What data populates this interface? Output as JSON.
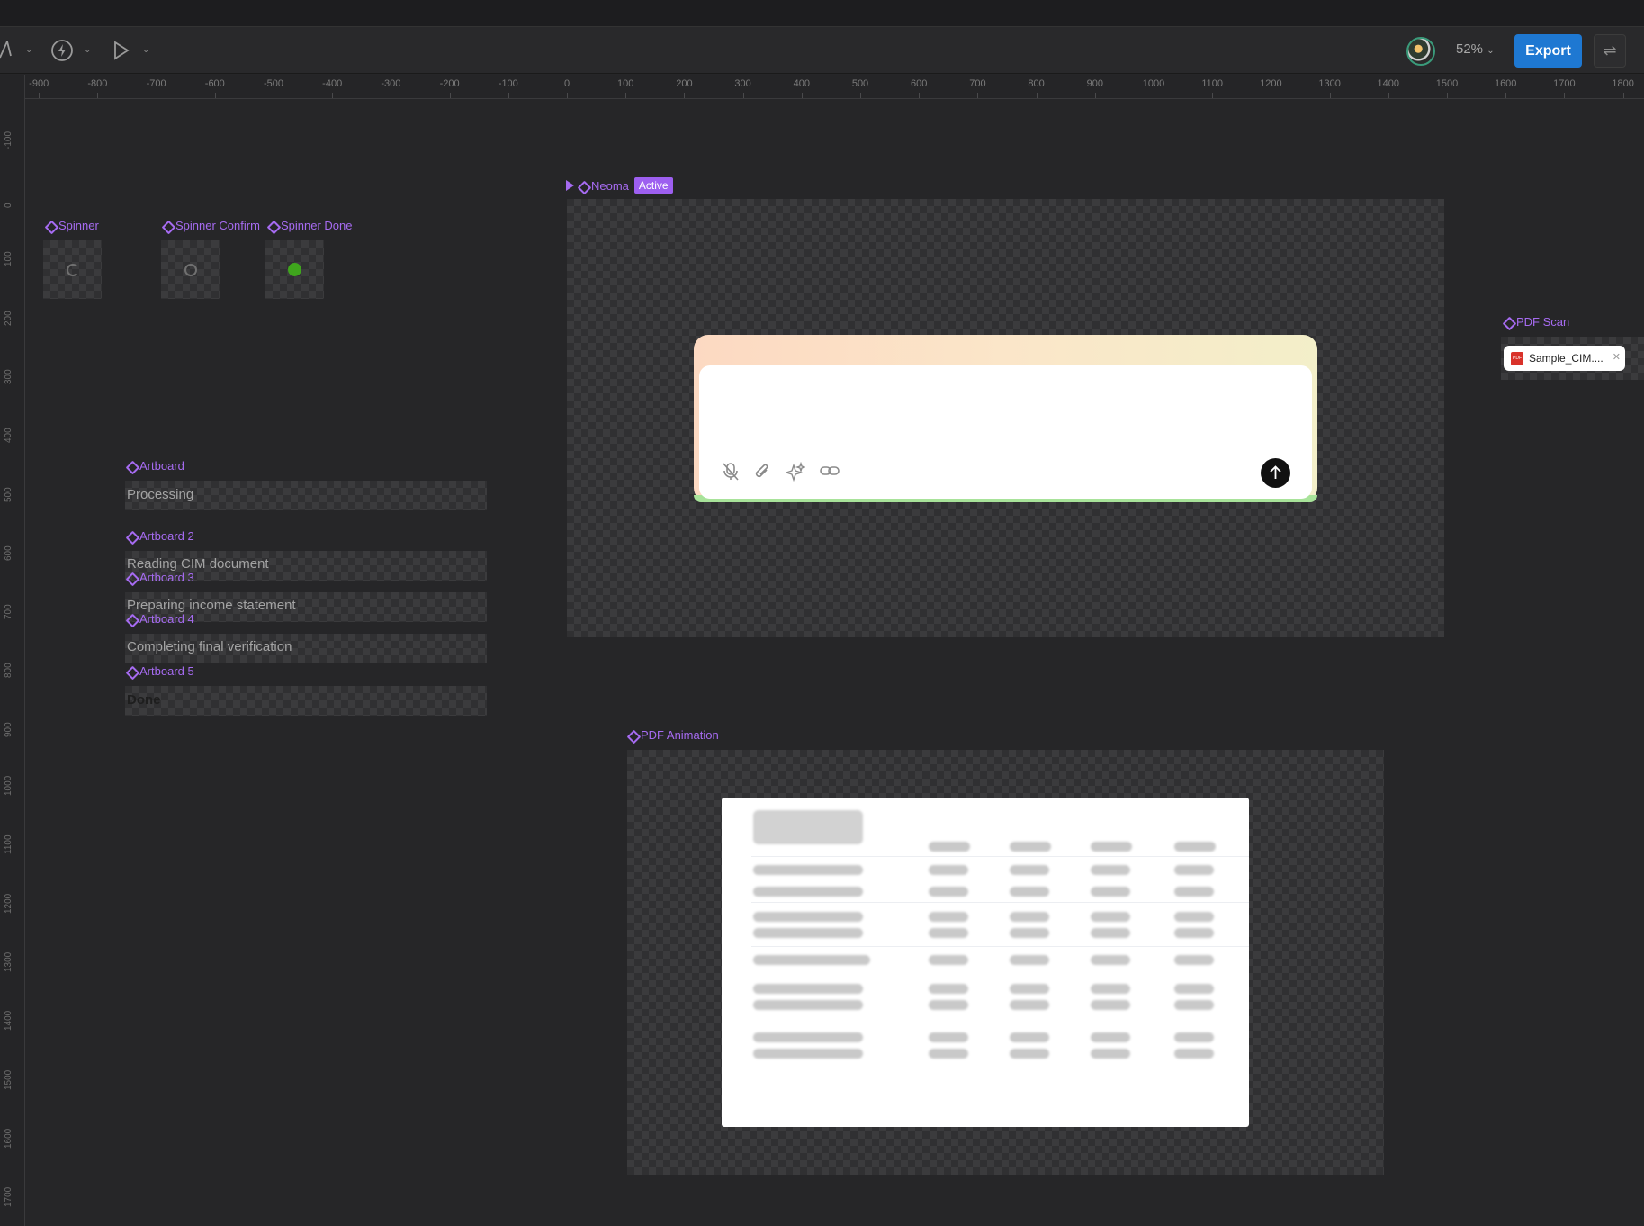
{
  "toolbar": {
    "zoom": "52%",
    "export_label": "Export"
  },
  "ruler": {
    "h_labels": [
      "-900",
      "-800",
      "-700",
      "-600",
      "-500",
      "-400",
      "-300",
      "-200",
      "-100",
      "0",
      "100",
      "200",
      "300",
      "400",
      "500",
      "600",
      "700",
      "800",
      "900",
      "1000",
      "1100",
      "1200",
      "1300",
      "1400",
      "1500",
      "1600",
      "1700",
      "1800"
    ],
    "v_labels": [
      "-100",
      "0",
      "100",
      "200",
      "300",
      "400",
      "500",
      "600",
      "700",
      "800",
      "900",
      "1000",
      "1100",
      "1200",
      "1300",
      "1400",
      "1500",
      "1600",
      "1700"
    ]
  },
  "frames": {
    "spinner": "Spinner",
    "spinner_confirm": "Spinner Confirm",
    "spinner_done": "Spinner Done",
    "neoma": "Neoma",
    "neoma_badge": "Active",
    "pdf_scan": "PDF Scan",
    "pdf_animation": "PDF Animation",
    "artboard_1": "Artboard",
    "artboard_2": "Artboard 2",
    "artboard_3": "Artboard 3",
    "artboard_4": "Artboard 4",
    "artboard_5": "Artboard 5"
  },
  "artboard_text": {
    "processing": "Processing",
    "reading": "Reading CIM document",
    "preparing": "Preparing income statement",
    "completing": "Completing final verification",
    "done": "Done"
  },
  "pdf_scan_chip": {
    "filename": "Sample_CIM....",
    "icon_text": "PDF"
  },
  "icons": [
    "pen-tool-icon",
    "lightning-icon",
    "play-icon",
    "mic-off-icon",
    "paperclip-icon",
    "sparkle-icon",
    "link-icon",
    "arrow-up-icon",
    "swap-icon",
    "component-icon"
  ],
  "colors": {
    "accent": "#1e78d2",
    "component_purple": "#a66bf1",
    "spinner_done_green": "#3fa51d"
  }
}
